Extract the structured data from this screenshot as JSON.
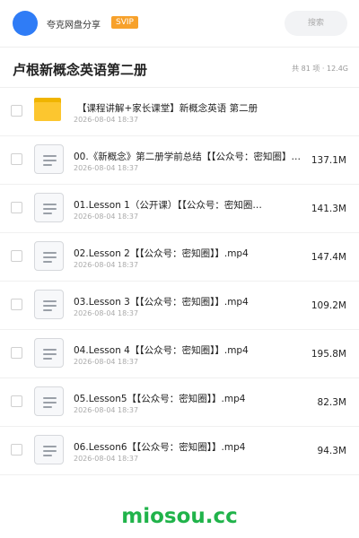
{
  "header": {
    "share_name": "夸克网盘分享",
    "badge": "SVIP",
    "search_placeholder": "搜索"
  },
  "folder": {
    "title": "卢根新概念英语第二册",
    "meta": "共 81 项 · 12.4G"
  },
  "files": [
    {
      "type": "folder",
      "name": "【课程讲解+家长课堂】新概念英语 第二册",
      "date": "2026-08-04 18:37",
      "size": ""
    },
    {
      "type": "file",
      "name": "00.《新概念》第二册学前总结【【公众号：密知圈】…",
      "date": "2026-08-04 18:37",
      "size": "137.1M"
    },
    {
      "type": "file",
      "name": "01.Lesson 1（公开课）【【公众号：密知圈…",
      "date": "2026-08-04 18:37",
      "size": "141.3M"
    },
    {
      "type": "file",
      "name": "02.Lesson 2【【公众号：密知圈】】.mp4",
      "date": "2026-08-04 18:37",
      "size": "147.4M"
    },
    {
      "type": "file",
      "name": "03.Lesson 3【【公众号：密知圈】】.mp4",
      "date": "2026-08-04 18:37",
      "size": "109.2M"
    },
    {
      "type": "file",
      "name": "04.Lesson 4【【公众号：密知圈】】.mp4",
      "date": "2026-08-04 18:37",
      "size": "195.8M"
    },
    {
      "type": "file",
      "name": "05.Lesson5【【公众号：密知圈】】.mp4",
      "date": "2026-08-04 18:37",
      "size": "82.3M"
    },
    {
      "type": "file",
      "name": "06.Lesson6【【公众号：密知圈】】.mp4",
      "date": "2026-08-04 18:37",
      "size": "94.3M"
    }
  ],
  "watermark": "miosou.cc",
  "colors": {
    "accent": "#2f7cf6",
    "badge": "#f7a12b",
    "folder": "#fcc62f",
    "watermark": "#20b34a"
  }
}
